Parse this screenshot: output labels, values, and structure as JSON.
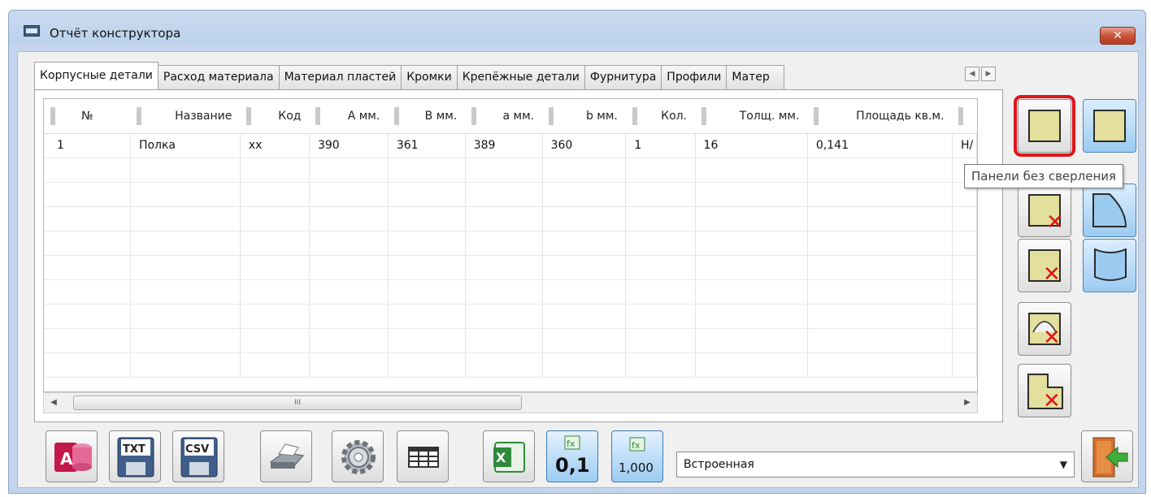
{
  "window": {
    "title": "Отчёт конструктора",
    "close_label": "✕"
  },
  "tabs": [
    {
      "label": "Корпусные детали",
      "active": true
    },
    {
      "label": "Расход материала"
    },
    {
      "label": "Материал пластей"
    },
    {
      "label": "Кромки"
    },
    {
      "label": "Крепёжные детали"
    },
    {
      "label": "Фурнитура"
    },
    {
      "label": "Профили"
    },
    {
      "label": "Матер"
    }
  ],
  "tab_scroll": {
    "left": "◀",
    "right": "▶"
  },
  "table": {
    "columns": [
      "№",
      "Название",
      "Код",
      "А мм.",
      "В мм.",
      "а мм.",
      "b мм.",
      "Кол.",
      "Толщ. мм.",
      "Площадь кв.м.",
      ""
    ],
    "rows": [
      [
        "1",
        "Полка",
        "xx",
        "390",
        "361",
        "389",
        "360",
        "1",
        "16",
        "0,141",
        "Н/"
      ]
    ]
  },
  "scrollbar": {
    "left": "◀",
    "right": "▶",
    "grip": "III"
  },
  "tooltip": "Панели без сверления",
  "bottom": {
    "txt_label": "TXT",
    "csv_label": "CSV",
    "fx_label": "fx",
    "fx1_value": "0,1",
    "fx2_value": "1,000",
    "select_value": "Встроенная"
  },
  "colors": {
    "highlight": "#e0141a",
    "panel_fill": "#e3df9c",
    "button_blue": "#9ccbf1"
  }
}
